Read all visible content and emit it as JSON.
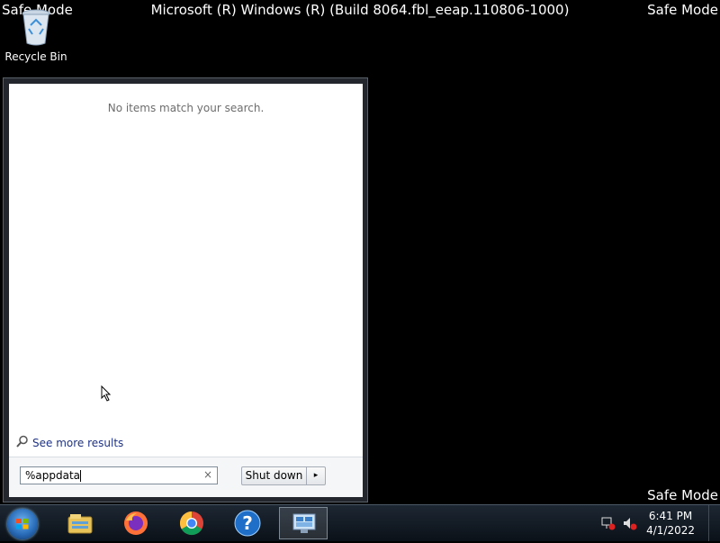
{
  "watermark": {
    "top_left": "Safe Mode",
    "top_right": "Safe Mode",
    "bottom_right": "Safe Mode",
    "build": "Microsoft (R) Windows (R) (Build 8064.fbl_eeap.110806-1000)"
  },
  "desktop": {
    "recycle_bin_label": "Recycle Bin"
  },
  "start_menu": {
    "no_results_text": "No items match your search.",
    "see_more_results": "See more results",
    "search_value": "%appdata",
    "clear_symbol": "×",
    "shutdown_label": "Shut down",
    "shutdown_arrow": "▸"
  },
  "taskbar": {
    "pinned": [
      {
        "icon": "windows-explorer-icon"
      },
      {
        "icon": "firefox-icon"
      },
      {
        "icon": "chrome-icon"
      },
      {
        "icon": "help-icon"
      },
      {
        "icon": "remote-desktop-icon",
        "active": true
      }
    ],
    "tray": {
      "network_icon": "network-icon",
      "volume_icon": "volume-muted-icon"
    },
    "clock": {
      "time": "6:41 PM",
      "date": "4/1/2022"
    }
  },
  "colors": {
    "desktop_bg": "#000000",
    "taskbar_bg": "#141c25",
    "link": "#1e3287"
  }
}
